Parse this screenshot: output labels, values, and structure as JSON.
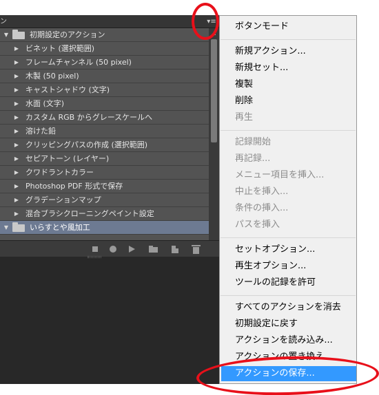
{
  "panel": {
    "tab_edge": "ン",
    "menu_icon": "▾≡",
    "rows": [
      {
        "kind": "set",
        "label": "初期設定のアクション",
        "arrow": "▼"
      },
      {
        "kind": "item",
        "label": "ビネット (選択範囲)",
        "arrow": "▶"
      },
      {
        "kind": "item",
        "label": "フレームチャンネル (50 pixel)",
        "arrow": "▶"
      },
      {
        "kind": "item",
        "label": "木製 (50 pixel)",
        "arrow": "▶"
      },
      {
        "kind": "item",
        "label": "キャストシャドウ (文字)",
        "arrow": "▶"
      },
      {
        "kind": "item",
        "label": "水面 (文字)",
        "arrow": "▶"
      },
      {
        "kind": "item",
        "label": "カスタム RGB からグレースケールへ",
        "arrow": "▶"
      },
      {
        "kind": "item",
        "label": "溶けた鉛",
        "arrow": "▶"
      },
      {
        "kind": "item",
        "label": "クリッピングパスの作成 (選択範囲)",
        "arrow": "▶"
      },
      {
        "kind": "item",
        "label": "セピアトーン (レイヤー)",
        "arrow": "▶"
      },
      {
        "kind": "item",
        "label": "クワドラントカラー",
        "arrow": "▶"
      },
      {
        "kind": "item",
        "label": "Photoshop PDF 形式で保存",
        "arrow": "▶"
      },
      {
        "kind": "item",
        "label": "グラデーションマップ",
        "arrow": "▶"
      },
      {
        "kind": "item",
        "label": "混合ブラシクローニングペイント設定",
        "arrow": "▶"
      },
      {
        "kind": "set",
        "label": "いらすとや風加工",
        "arrow": "▼",
        "selected": true
      }
    ]
  },
  "menu": {
    "items": [
      {
        "label": "ボタンモード",
        "disabled": false
      },
      {
        "sep": true
      },
      {
        "label": "新規アクション...",
        "disabled": false
      },
      {
        "label": "新規セット...",
        "disabled": false
      },
      {
        "label": "複製",
        "disabled": false
      },
      {
        "label": "削除",
        "disabled": false
      },
      {
        "label": "再生",
        "disabled": true
      },
      {
        "sep": true
      },
      {
        "label": "記録開始",
        "disabled": true
      },
      {
        "label": "再記録...",
        "disabled": true
      },
      {
        "label": "メニュー項目を挿入...",
        "disabled": true
      },
      {
        "label": "中止を挿入...",
        "disabled": true
      },
      {
        "label": "条件の挿入...",
        "disabled": true
      },
      {
        "label": "パスを挿入",
        "disabled": true
      },
      {
        "sep": true
      },
      {
        "label": "セットオプション...",
        "disabled": false
      },
      {
        "label": "再生オプション...",
        "disabled": false
      },
      {
        "label": "ツールの記録を許可",
        "disabled": false
      },
      {
        "sep": true
      },
      {
        "label": "すべてのアクションを消去",
        "disabled": false
      },
      {
        "label": "初期設定に戻す",
        "disabled": false
      },
      {
        "label": "アクションを読み込み...",
        "disabled": false
      },
      {
        "label": "アクションの置き換え...",
        "disabled": false
      },
      {
        "label": "アクションの保存...",
        "disabled": false,
        "highlighted": true
      }
    ]
  },
  "colors": {
    "annotation": "#e8101a",
    "menu_highlight": "#3399ff",
    "selected_row": "#6d7a92"
  }
}
